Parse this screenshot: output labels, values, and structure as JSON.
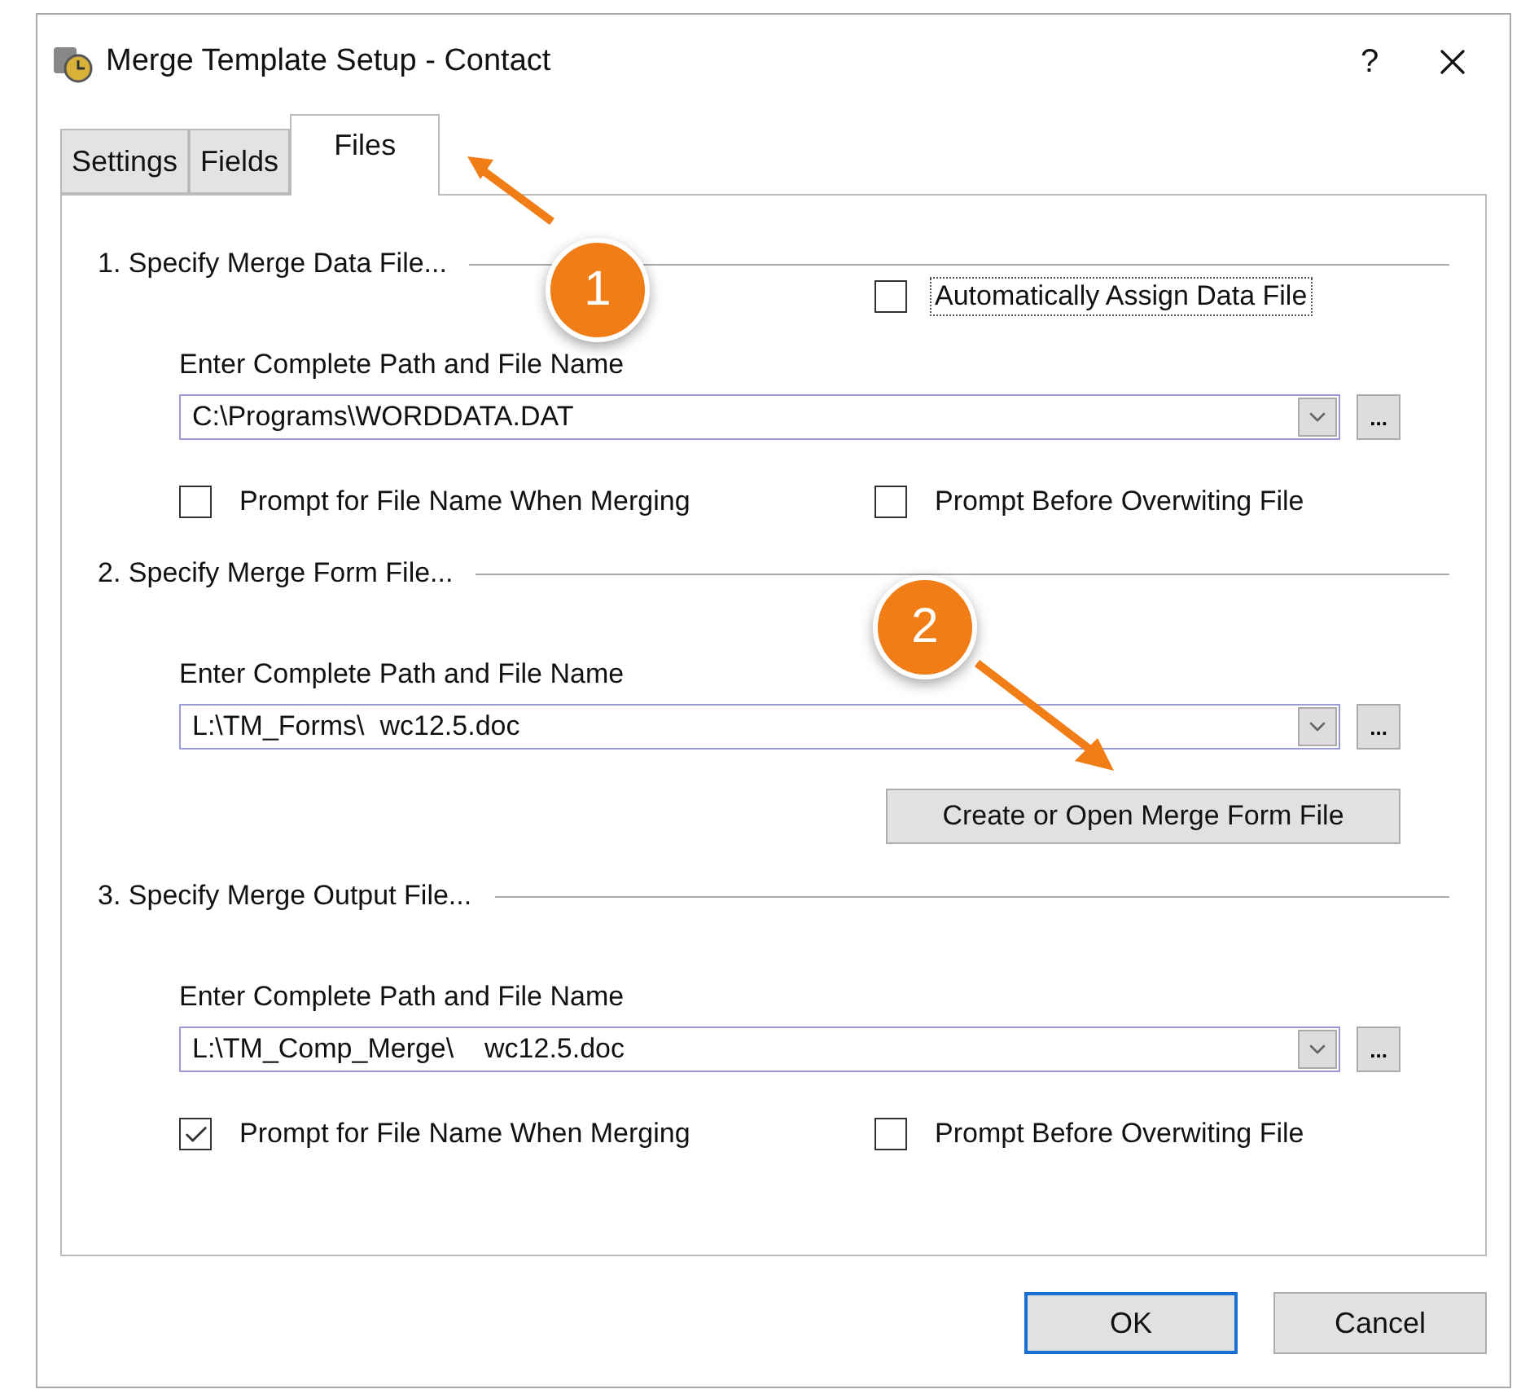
{
  "window": {
    "title": "Merge Template Setup - Contact",
    "help": "?"
  },
  "tabs": [
    {
      "label": "Settings",
      "selected": false
    },
    {
      "label": "Fields",
      "selected": false
    },
    {
      "label": "Files",
      "selected": true
    }
  ],
  "sections": [
    {
      "heading": "1. Specify Merge Data File...",
      "auto_assign": {
        "label": "Automatically Assign Data File",
        "checked": false
      },
      "field_label": "Enter Complete Path and File Name",
      "value": "C:\\Programs\\WORDDATA.DAT",
      "browse": "...",
      "checkboxes": [
        {
          "label": "Prompt for File Name When Merging",
          "checked": false
        },
        {
          "label": "Prompt Before Overwiting File",
          "checked": false
        }
      ]
    },
    {
      "heading": "2. Specify Merge Form File...",
      "field_label": "Enter Complete Path and File Name",
      "value": "L:\\TM_Forms\\  wc12.5.doc",
      "browse": "...",
      "action_button": "Create or Open Merge Form File"
    },
    {
      "heading": "3. Specify Merge Output File...",
      "field_label": "Enter Complete Path and File Name",
      "value": "L:\\TM_Comp_Merge\\    wc12.5.doc",
      "browse": "...",
      "checkboxes": [
        {
          "label": "Prompt for File Name When Merging",
          "checked": true
        },
        {
          "label": "Prompt Before Overwiting File",
          "checked": false
        }
      ]
    }
  ],
  "buttons": [
    {
      "label": "OK",
      "default": true
    },
    {
      "label": "Cancel",
      "default": false
    }
  ],
  "callouts": [
    {
      "number": "1"
    },
    {
      "number": "2"
    }
  ]
}
